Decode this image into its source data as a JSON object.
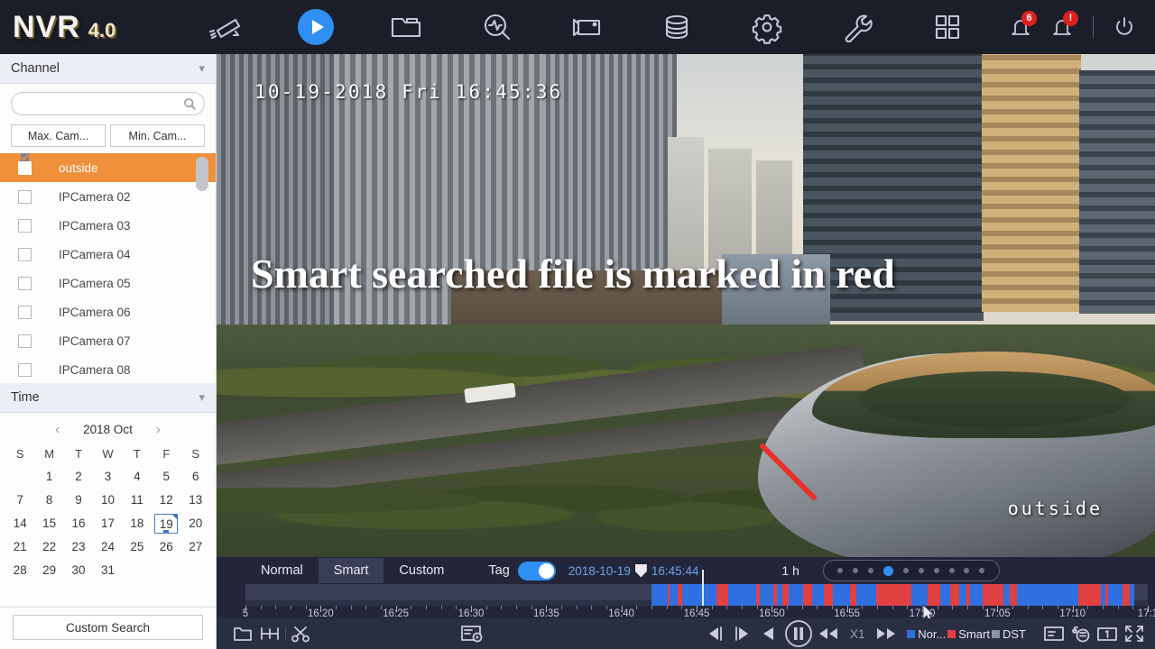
{
  "brand": {
    "name": "NVR",
    "version": "4.0"
  },
  "topnav": {
    "items": [
      {
        "name": "camera-icon",
        "label": "Live View"
      },
      {
        "name": "play-icon",
        "label": "Playback",
        "active": true
      },
      {
        "name": "folder-icon",
        "label": "File Management"
      },
      {
        "name": "search-analytics-icon",
        "label": "Smart Analysis"
      },
      {
        "name": "record-icon",
        "label": "Record"
      },
      {
        "name": "storage-icon",
        "label": "Storage"
      },
      {
        "name": "gear-icon",
        "label": "System Configuration"
      },
      {
        "name": "wrench-icon",
        "label": "Maintenance"
      },
      {
        "name": "grid-icon",
        "label": "Layout"
      }
    ],
    "alarm_badge": "6",
    "warning_badge": "!",
    "power_label": "Power"
  },
  "sidebar": {
    "channel_panel": {
      "title": "Channel"
    },
    "search": {
      "value": "",
      "placeholder": ""
    },
    "buttons": {
      "max_camera": "Max. Cam...",
      "min_camera": "Min. Cam..."
    },
    "channels": [
      {
        "label": "outside",
        "checked": true,
        "selected": true
      },
      {
        "label": "IPCamera 02",
        "checked": false,
        "selected": false
      },
      {
        "label": "IPCamera 03",
        "checked": false,
        "selected": false
      },
      {
        "label": "IPCamera 04",
        "checked": false,
        "selected": false
      },
      {
        "label": "IPCamera 05",
        "checked": false,
        "selected": false
      },
      {
        "label": "IPCamera 06",
        "checked": false,
        "selected": false
      },
      {
        "label": "IPCamera 07",
        "checked": false,
        "selected": false
      },
      {
        "label": "IPCamera 08",
        "checked": false,
        "selected": false
      }
    ],
    "time_panel": {
      "title": "Time"
    },
    "calendar": {
      "month_label": "2018 Oct",
      "prev": "‹",
      "next": "›",
      "weekdays": [
        "S",
        "M",
        "T",
        "W",
        "T",
        "F",
        "S"
      ],
      "weeks": [
        [
          "",
          "1",
          "2",
          "3",
          "4",
          "5",
          "6"
        ],
        [
          "7",
          "8",
          "9",
          "10",
          "11",
          "12",
          "13"
        ],
        [
          "14",
          "15",
          "16",
          "17",
          "18",
          "19",
          "20"
        ],
        [
          "21",
          "22",
          "23",
          "24",
          "25",
          "26",
          "27"
        ],
        [
          "28",
          "29",
          "30",
          "31",
          "",
          "",
          ""
        ]
      ],
      "selected_day": "19"
    },
    "custom_search_label": "Custom Search"
  },
  "video": {
    "osd_timestamp": "10-19-2018 Fri 16:45:36",
    "channel_name": "outside",
    "banner_text": "Smart searched file is marked in red"
  },
  "timeline": {
    "tabs": [
      {
        "label": "Normal",
        "active": false
      },
      {
        "label": "Smart",
        "active": true
      },
      {
        "label": "Custom",
        "active": false
      }
    ],
    "tag_label": "Tag",
    "tag_on": true,
    "current_datetime": "2018-10-19",
    "current_time": "16:45:44",
    "span_label": "1 h",
    "zoom_dots": 10,
    "zoom_active_index": 3,
    "tick_labels": [
      "5",
      "16:20",
      "16:25",
      "16:30",
      "16:35",
      "16:40",
      "16:45",
      "16:50",
      "16:55",
      "17:00",
      "17:05",
      "17:10",
      "17:1"
    ],
    "playhead_percent": 50.6
  },
  "controls": {
    "left_icons": [
      {
        "name": "folder-icon",
        "label": "File"
      },
      {
        "name": "clip-markers-icon",
        "label": "Clip"
      },
      {
        "name": "scissors-icon",
        "label": "Cut"
      },
      {
        "name": "file-play-icon",
        "label": "File List"
      }
    ],
    "transport": [
      {
        "name": "frame-backward-icon",
        "label": "Previous Frame"
      },
      {
        "name": "frame-forward-icon",
        "label": "Next Frame"
      },
      {
        "name": "reverse-play-icon",
        "label": "Reverse Play"
      },
      {
        "name": "pause-icon",
        "label": "Pause"
      },
      {
        "name": "rewind-icon",
        "label": "Slow Forward"
      }
    ],
    "speed_label": "X1",
    "forward_icon": {
      "name": "fast-forward-icon",
      "label": "Fast Forward"
    },
    "legend": [
      {
        "label": "Nor...",
        "color": "#2f6fe0"
      },
      {
        "label": "Smart",
        "color": "#e04040"
      },
      {
        "label": "DST",
        "color": "#8c90a6"
      }
    ],
    "right_icons": [
      {
        "name": "list-icon",
        "label": "File List"
      },
      {
        "name": "snapshot-icon",
        "label": "Capture"
      },
      {
        "name": "single-window-icon",
        "label": "1"
      },
      {
        "name": "fullscreen-icon",
        "label": "Full Screen"
      }
    ]
  },
  "colors": {
    "accent": "#2f8ff5",
    "selection": "#f0903b",
    "alarm": "#e02020",
    "normal_record": "#2f6fe0",
    "smart_record": "#e04040"
  }
}
